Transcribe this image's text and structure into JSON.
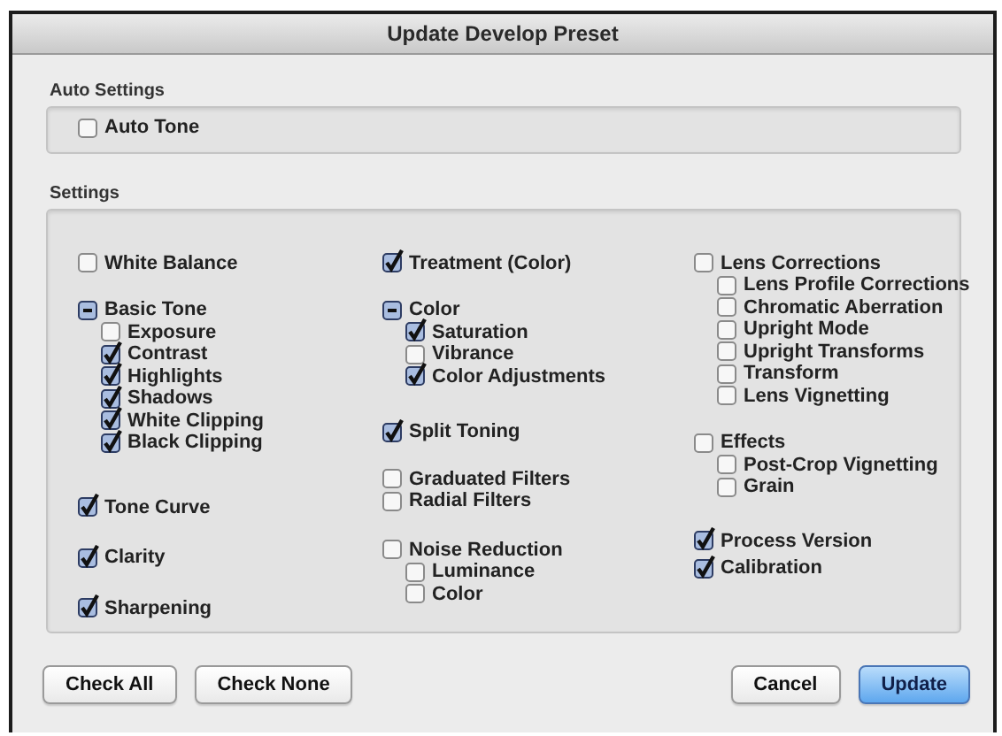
{
  "window": {
    "title": "Update Develop Preset"
  },
  "auto_settings": {
    "title": "Auto Settings",
    "items": [
      {
        "label": "Auto Tone",
        "checked": false
      }
    ]
  },
  "settings": {
    "title": "Settings",
    "columns": [
      {
        "groups": [
          {
            "items": [
              {
                "label": "White Balance",
                "checked": false
              }
            ]
          },
          {
            "items": [
              {
                "label": "Basic Tone",
                "checked": false,
                "mixed": true,
                "children": [
                  {
                    "label": "Exposure",
                    "checked": false
                  },
                  {
                    "label": "Contrast",
                    "checked": true
                  },
                  {
                    "label": "Highlights",
                    "checked": true
                  },
                  {
                    "label": "Shadows",
                    "checked": true
                  },
                  {
                    "label": "White Clipping",
                    "checked": true
                  },
                  {
                    "label": "Black Clipping",
                    "checked": true
                  }
                ]
              }
            ]
          },
          {
            "items": [
              {
                "label": "Tone Curve",
                "checked": true
              }
            ]
          },
          {
            "items": [
              {
                "label": "Clarity",
                "checked": true
              }
            ]
          },
          {
            "items": [
              {
                "label": "Sharpening",
                "checked": true
              }
            ]
          }
        ]
      },
      {
        "groups": [
          {
            "items": [
              {
                "label": "Treatment (Color)",
                "checked": true
              }
            ]
          },
          {
            "items": [
              {
                "label": "Color",
                "checked": false,
                "mixed": true,
                "children": [
                  {
                    "label": "Saturation",
                    "checked": true
                  },
                  {
                    "label": "Vibrance",
                    "checked": false
                  },
                  {
                    "label": "Color Adjustments",
                    "checked": true
                  }
                ]
              }
            ]
          },
          {
            "items": [
              {
                "label": "Split Toning",
                "checked": true
              }
            ]
          },
          {
            "items": [
              {
                "label": "Graduated Filters",
                "checked": false
              },
              {
                "label": "Radial Filters",
                "checked": false
              }
            ]
          },
          {
            "items": [
              {
                "label": "Noise Reduction",
                "checked": false,
                "mixed": false,
                "children": [
                  {
                    "label": "Luminance",
                    "checked": false
                  },
                  {
                    "label": "Color",
                    "checked": false
                  }
                ]
              }
            ]
          }
        ]
      },
      {
        "groups": [
          {
            "items": [
              {
                "label": "Lens Corrections",
                "checked": false,
                "mixed": false,
                "children": [
                  {
                    "label": "Lens Profile Corrections",
                    "checked": false
                  },
                  {
                    "label": "Chromatic Aberration",
                    "checked": false
                  },
                  {
                    "label": "Upright Mode",
                    "checked": false
                  },
                  {
                    "label": "Upright Transforms",
                    "checked": false
                  },
                  {
                    "label": "Transform",
                    "checked": false
                  },
                  {
                    "label": "Lens Vignetting",
                    "checked": false
                  }
                ]
              }
            ]
          },
          {
            "items": [
              {
                "label": "Effects",
                "checked": false,
                "mixed": false,
                "children": [
                  {
                    "label": "Post-Crop Vignetting",
                    "checked": false
                  },
                  {
                    "label": "Grain",
                    "checked": false
                  }
                ]
              }
            ]
          },
          {
            "items": [
              {
                "label": "Process Version",
                "checked": true
              },
              {
                "label": "Calibration",
                "checked": true
              }
            ]
          }
        ]
      }
    ]
  },
  "buttons": [
    {
      "label": "Check All",
      "default": false
    },
    {
      "label": "Check None",
      "default": false
    },
    {
      "label": "Cancel",
      "default": false
    },
    {
      "label": "Update",
      "default": true
    }
  ]
}
